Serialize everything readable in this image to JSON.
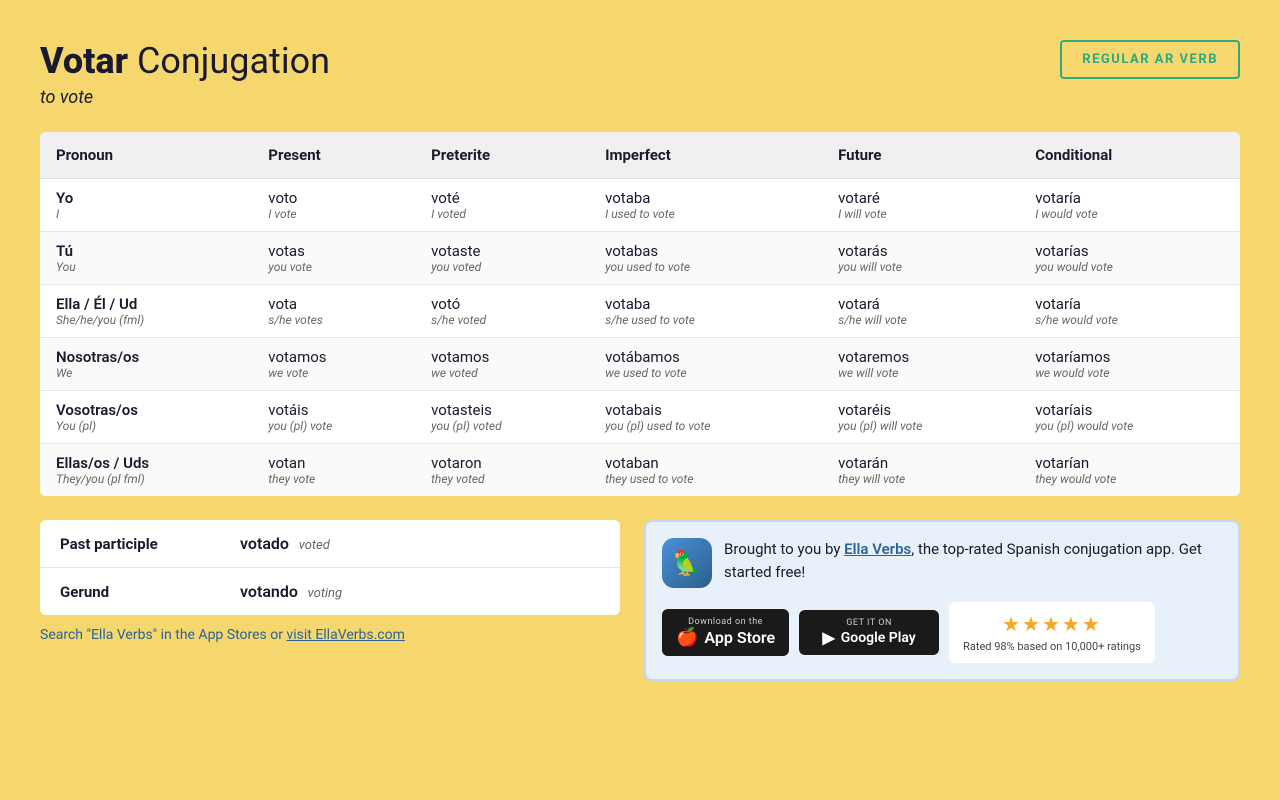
{
  "header": {
    "title_bold": "Votar",
    "title_normal": " Conjugation",
    "subtitle": "to vote",
    "badge": "REGULAR AR VERB"
  },
  "table": {
    "columns": [
      "Pronoun",
      "Present",
      "Preterite",
      "Imperfect",
      "Future",
      "Conditional"
    ],
    "rows": [
      {
        "pronoun": "Yo",
        "pronoun_sub": "I",
        "present": "voto",
        "present_sub": "I vote",
        "preterite": "voté",
        "preterite_sub": "I voted",
        "imperfect": "votaba",
        "imperfect_sub": "I used to vote",
        "future": "votaré",
        "future_sub": "I will vote",
        "conditional": "votaría",
        "conditional_sub": "I would vote"
      },
      {
        "pronoun": "Tú",
        "pronoun_sub": "You",
        "present": "votas",
        "present_sub": "you vote",
        "preterite": "votaste",
        "preterite_sub": "you voted",
        "imperfect": "votabas",
        "imperfect_sub": "you used to vote",
        "future": "votarás",
        "future_sub": "you will vote",
        "conditional": "votarías",
        "conditional_sub": "you would vote"
      },
      {
        "pronoun": "Ella / Él / Ud",
        "pronoun_sub": "She/he/you (fml)",
        "present": "vota",
        "present_sub": "s/he votes",
        "preterite": "votó",
        "preterite_sub": "s/he voted",
        "imperfect": "votaba",
        "imperfect_sub": "s/he used to vote",
        "future": "votará",
        "future_sub": "s/he will vote",
        "conditional": "votaría",
        "conditional_sub": "s/he would vote"
      },
      {
        "pronoun": "Nosotras/os",
        "pronoun_sub": "We",
        "present": "votamos",
        "present_sub": "we vote",
        "preterite": "votamos",
        "preterite_sub": "we voted",
        "imperfect": "votábamos",
        "imperfect_sub": "we used to vote",
        "future": "votaremos",
        "future_sub": "we will vote",
        "conditional": "votaríamos",
        "conditional_sub": "we would vote"
      },
      {
        "pronoun": "Vosotras/os",
        "pronoun_sub": "You (pl)",
        "present": "votáis",
        "present_sub": "you (pl) vote",
        "preterite": "votasteis",
        "preterite_sub": "you (pl) voted",
        "imperfect": "votabais",
        "imperfect_sub": "you (pl) used to vote",
        "future": "votaréis",
        "future_sub": "you (pl) will vote",
        "conditional": "votaríais",
        "conditional_sub": "you (pl) would vote"
      },
      {
        "pronoun": "Ellas/os / Uds",
        "pronoun_sub": "They/you (pl fml)",
        "present": "votan",
        "present_sub": "they vote",
        "preterite": "votaron",
        "preterite_sub": "they voted",
        "imperfect": "votaban",
        "imperfect_sub": "they used to vote",
        "future": "votarán",
        "future_sub": "they will vote",
        "conditional": "votarían",
        "conditional_sub": "they would vote"
      }
    ]
  },
  "participle": {
    "past_label": "Past participle",
    "past_value": "votado",
    "past_translation": "voted",
    "gerund_label": "Gerund",
    "gerund_value": "votando",
    "gerund_translation": "voting"
  },
  "search_text": "Search \"Ella Verbs\" in the App Stores or ",
  "search_link": "visit EllaVerbs.com",
  "promo": {
    "text_before": "Brought to you by ",
    "link_text": "Ella Verbs",
    "text_after": ", the top-rated Spanish conjugation app. Get started free!",
    "app_store_small": "Download on the",
    "app_store_big": "App Store",
    "google_play_small": "GET IT ON",
    "google_play_big": "Google Play",
    "rating_text": "Rated 98% based on 10,000+ ratings",
    "stars": "★★★★★"
  }
}
